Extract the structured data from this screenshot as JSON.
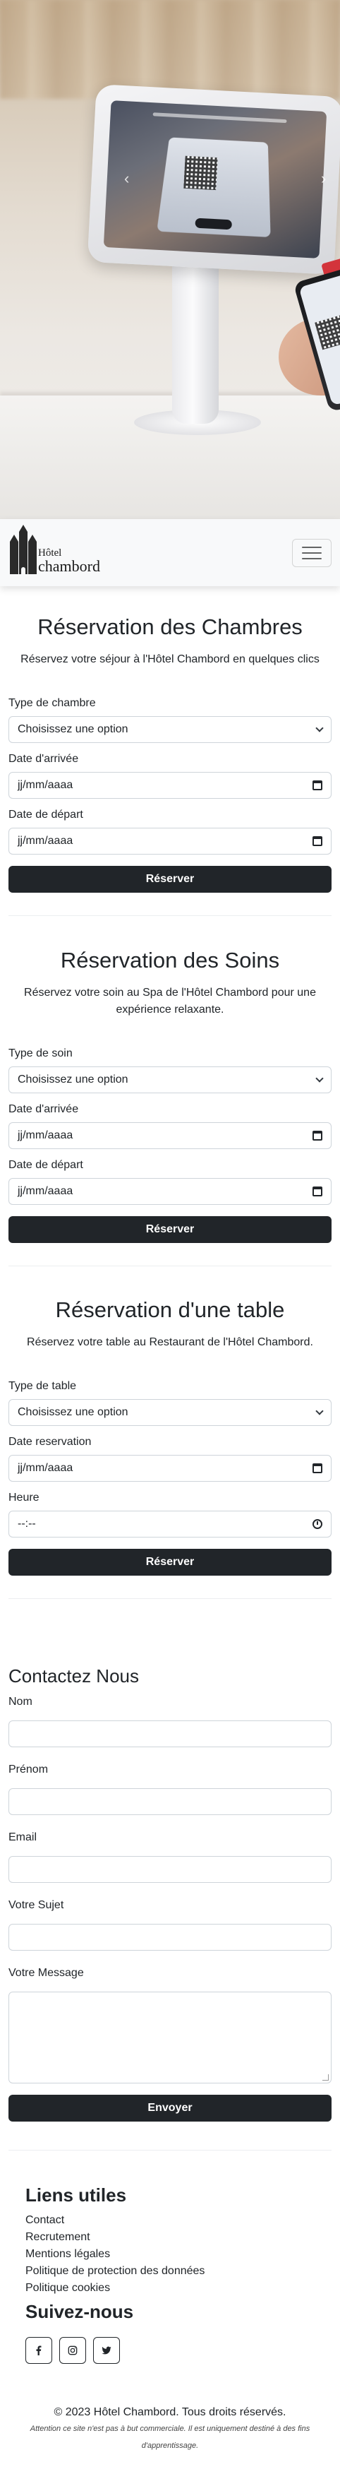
{
  "navbar": {
    "brand_line1": "Hôtel",
    "brand_line2": "chambord"
  },
  "rooms": {
    "title": "Réservation des Chambres",
    "subtitle": "Réservez votre séjour à l'Hôtel Chambord en quelques clics",
    "type_label": "Type de chambre",
    "type_value": "Choisissez une option",
    "arrival_label": "Date d'arrivée",
    "arrival_value": "jj/mm/aaaa",
    "departure_label": "Date de départ",
    "departure_value": "jj/mm/aaaa",
    "submit_label": "Réserver"
  },
  "spa": {
    "title": "Réservation des Soins",
    "subtitle": "Réservez votre soin au Spa de l'Hôtel Chambord pour une expérience relaxante.",
    "type_label": "Type de soin",
    "type_value": "Choisissez une option",
    "arrival_label": "Date d'arrivée",
    "arrival_value": "jj/mm/aaaa",
    "departure_label": "Date de départ",
    "departure_value": "jj/mm/aaaa",
    "submit_label": "Réserver"
  },
  "table": {
    "title": "Réservation d'une table",
    "subtitle": "Réservez votre table au Restaurant de l'Hôtel Chambord.",
    "type_label": "Type de table",
    "type_value": "Choisissez une option",
    "date_label": "Date reservation",
    "date_value": "jj/mm/aaaa",
    "time_label": "Heure",
    "time_value": "--:--",
    "submit_label": "Réserver"
  },
  "contact": {
    "title": "Contactez Nous",
    "name_label": "Nom",
    "firstname_label": "Prénom",
    "email_label": "Email",
    "subject_label": "Votre Sujet",
    "message_label": "Votre Message",
    "submit_label": "Envoyer"
  },
  "footer": {
    "links_title": "Liens utiles",
    "links": [
      "Contact",
      "Recrutement",
      "Mentions légales",
      "Politique de protection des données",
      "Politique cookies"
    ],
    "follow_title": "Suivez-nous",
    "socials": [
      "facebook-icon",
      "instagram-icon",
      "twitter-icon"
    ],
    "copyright": "© 2023 Hôtel Chambord. Tous droits réservés.",
    "disclaimer": "Attention ce site n'est pas à but commerciale. Il est uniquement destiné à des fins d'apprentissage."
  }
}
